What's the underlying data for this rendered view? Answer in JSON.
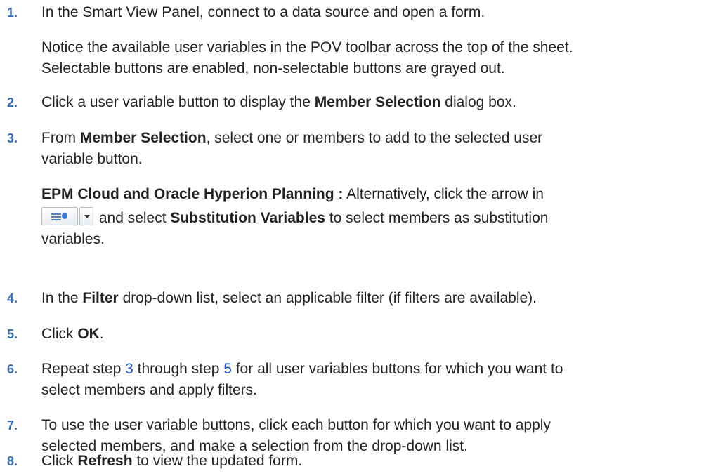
{
  "steps": [
    {
      "num": "1.",
      "text": "In the Smart View Panel, connect to a data source and open a form."
    },
    {
      "num": "2.",
      "pre": "Click a user variable button to display the ",
      "bold": "Member Selection",
      "post": " dialog box."
    },
    {
      "num": "3.",
      "pre": "From ",
      "bold": "Member Selection",
      "post1": ", select one or members to add to the selected user",
      "post2": "variable button."
    },
    {
      "num": "4.",
      "pre": "In the ",
      "bold": "Filter",
      "post": " drop-down list, select an applicable filter (if filters are available)."
    },
    {
      "num": "5.",
      "pre": "Click ",
      "bold": "OK",
      "post": "."
    },
    {
      "num": "6.",
      "pre": "Repeat step ",
      "link1": "3",
      "mid": " through step ",
      "link2": "5",
      "post1": " for all user variables buttons for which you want to",
      "post2": "select members and apply filters."
    },
    {
      "num": "7.",
      "line1": "To use the user variable buttons, click each button for which you want to apply",
      "line2": "selected members, and make a selection from the drop-down list."
    },
    {
      "num": "8.",
      "pre": "Click ",
      "bold": "Refresh",
      "post": " to view the updated form."
    }
  ],
  "note1": {
    "line1": "Notice the available user variables in the POV toolbar across the top of the sheet.",
    "line2": "Selectable buttons are enabled, non-selectable buttons are grayed out."
  },
  "note3": {
    "bold": "EPM Cloud and Oracle Hyperion Planning :",
    "line1_post": " Alternatively, click the arrow in",
    "line2_pre": " and select ",
    "line2_bold": "Substitution Variables",
    "line2_post": " to select members as substitution",
    "line3": "variables.",
    "icon": "member-list-dropdown-icon"
  },
  "colors": {
    "step_number": "#3a6db1",
    "link": "#1a4fc9",
    "text": "#222222"
  }
}
